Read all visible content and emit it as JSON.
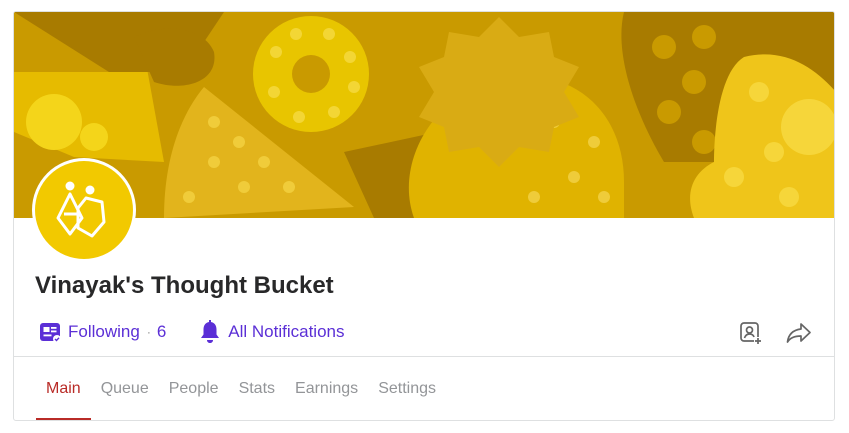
{
  "space": {
    "title": "Vinayak's Thought Bucket"
  },
  "actions": {
    "following_label": "Following",
    "following_separator": "·",
    "following_count": "6",
    "notifications_label": "All Notifications"
  },
  "icons": {
    "following": "space-follow-icon",
    "notifications": "bell-icon",
    "invite": "add-contributor-icon",
    "share": "share-arrow-icon"
  },
  "tabs": [
    {
      "label": "Main",
      "active": true
    },
    {
      "label": "Queue",
      "active": false
    },
    {
      "label": "People",
      "active": false
    },
    {
      "label": "Stats",
      "active": false
    },
    {
      "label": "Earnings",
      "active": false
    },
    {
      "label": "Settings",
      "active": false
    }
  ],
  "colors": {
    "accent_purple": "#5b2fd6",
    "active_tab": "#b92b27",
    "banner_yellow": "#c99a00",
    "avatar_yellow": "#f2c900"
  }
}
